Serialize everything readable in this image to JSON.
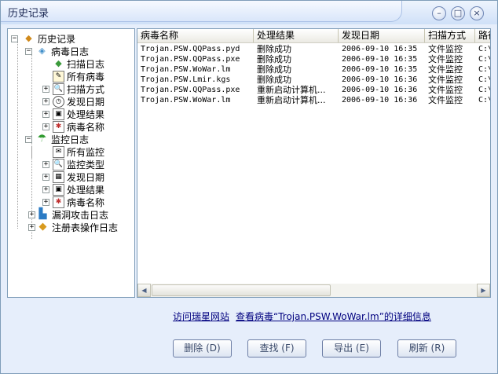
{
  "window": {
    "title": "历史记录",
    "buttons": {
      "minimize": "–",
      "maximize": "□",
      "close": "×"
    }
  },
  "tree": [
    {
      "label": "历史记录",
      "icon": "history-icon"
    },
    {
      "label": "病毒日志",
      "icon": "virus-log-icon"
    },
    {
      "label": "扫描日志",
      "icon": "scan-log-icon"
    },
    {
      "label": "所有病毒",
      "icon": "all-viruses-icon"
    },
    {
      "label": "扫描方式",
      "icon": "scan-mode-icon"
    },
    {
      "label": "发现日期",
      "icon": "calendar-icon"
    },
    {
      "label": "处理结果",
      "icon": "result-icon"
    },
    {
      "label": "病毒名称",
      "icon": "virus-name-icon"
    },
    {
      "label": "监控日志",
      "icon": "monitor-log-icon"
    },
    {
      "label": "所有监控",
      "icon": "all-monitors-icon"
    },
    {
      "label": "监控类型",
      "icon": "monitor-type-icon"
    },
    {
      "label": "发现日期",
      "icon": "calendar-icon"
    },
    {
      "label": "处理结果",
      "icon": "result-icon"
    },
    {
      "label": "病毒名称",
      "icon": "virus-name-icon"
    },
    {
      "label": "漏洞攻击日志",
      "icon": "exploit-log-icon"
    },
    {
      "label": "注册表操作日志",
      "icon": "registry-log-icon"
    }
  ],
  "table": {
    "columns": [
      "病毒名称",
      "处理结果",
      "发现日期",
      "扫描方式",
      "路径"
    ],
    "rows": [
      [
        "Trojan.PSW.QQPass.pyd",
        "删除成功",
        "2006-09-10  16:35",
        "文件监控",
        "C:\\"
      ],
      [
        "Trojan.PSW.QQPass.pxe",
        "删除成功",
        "2006-09-10  16:35",
        "文件监控",
        "C:\\"
      ],
      [
        "Trojan.PSW.WoWar.lm",
        "删除成功",
        "2006-09-10  16:35",
        "文件监控",
        "C:\\"
      ],
      [
        "Trojan.PSW.Lmir.kgs",
        "删除成功",
        "2006-09-10  16:36",
        "文件监控",
        "C:\\"
      ],
      [
        "Trojan.PSW.QQPass.pxe",
        "重新启动计算机...",
        "2006-09-10  16:36",
        "文件监控",
        "C:\\"
      ],
      [
        "Trojan.PSW.WoWar.lm",
        "重新启动计算机...",
        "2006-09-10  16:36",
        "文件监控",
        "C:\\"
      ]
    ]
  },
  "links": {
    "visit": "访问瑞星网站",
    "detail": "查看病毒“Trojan.PSW.WoWar.lm”的详细信息"
  },
  "buttons": {
    "delete": "删除 (D)",
    "find": "查找 (F)",
    "export": "导出 (E)",
    "refresh": "刷新 (R)"
  }
}
